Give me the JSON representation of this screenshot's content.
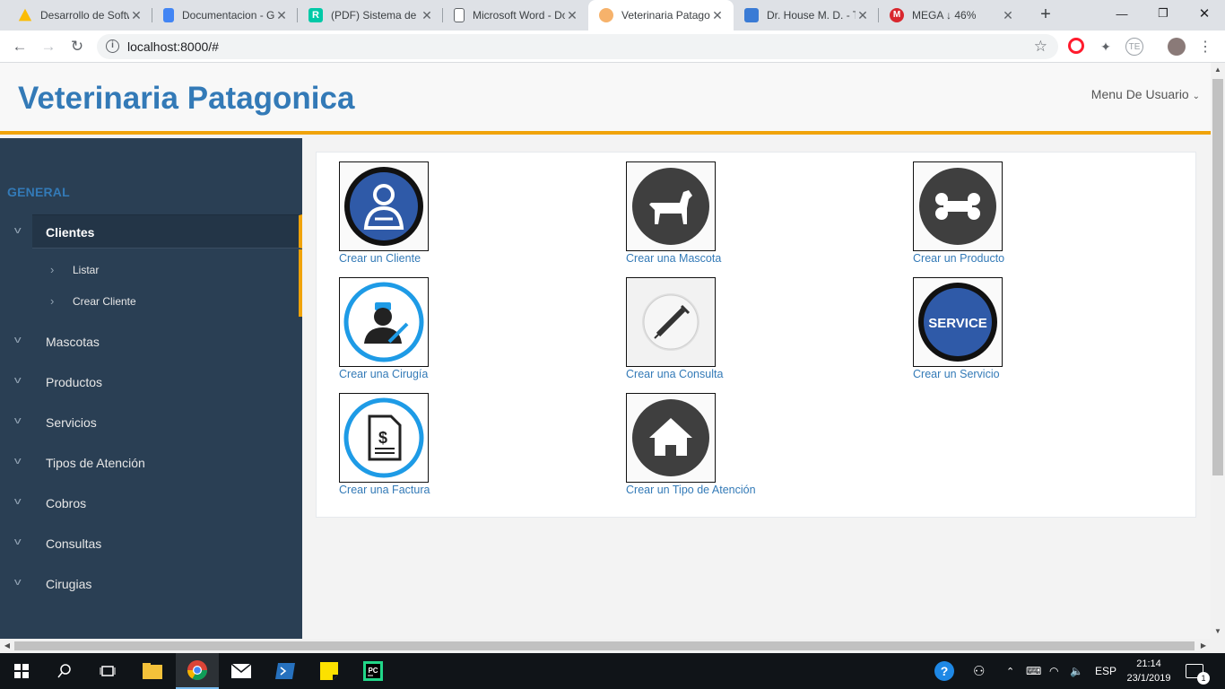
{
  "browser": {
    "tabs": [
      {
        "title": "Desarrollo de Software",
        "color": "#fbbc04",
        "active": false
      },
      {
        "title": "Documentacion - Google Docs",
        "color": "#4285f4",
        "active": false
      },
      {
        "title": "(PDF) Sistema de Gestión",
        "color": "#00c9a7",
        "active": false
      },
      {
        "title": "Microsoft Word - Document",
        "color": "#ffffff",
        "active": false
      },
      {
        "title": "Veterinaria Patagonica",
        "color": "#f6b26b",
        "active": true
      },
      {
        "title": "Dr. House M. D. - Temporada",
        "color": "#3a7bd5",
        "active": false
      },
      {
        "title": "MEGA ↓ 46%",
        "color": "#d9272e",
        "active": false
      }
    ],
    "url": "localhost:8000/#"
  },
  "header": {
    "brand": "Veterinaria Patagonica",
    "user_menu": "Menu De Usuario"
  },
  "sidebar": {
    "section": "GENERAL",
    "active_item": "Clientes",
    "sub_items": [
      "Listar",
      "Crear Cliente"
    ],
    "items": [
      "Mascotas",
      "Productos",
      "Servicios",
      "Tipos de Atención",
      "Cobros",
      "Consultas",
      "Cirugias"
    ]
  },
  "tiles": [
    {
      "caption": "Crear un Cliente",
      "icon": "user-icon"
    },
    {
      "caption": "Crear una Mascota",
      "icon": "dog-icon"
    },
    {
      "caption": "Crear un Producto",
      "icon": "bone-icon"
    },
    {
      "caption": "Crear una Cirugía",
      "icon": "surgeon-icon"
    },
    {
      "caption": "Crear una Consulta",
      "icon": "syringe-icon"
    },
    {
      "caption": "Crear un Servicio",
      "icon": "service-icon"
    },
    {
      "caption": "Crear una Factura",
      "icon": "invoice-icon"
    },
    {
      "caption": "Crear un Tipo de Atención",
      "icon": "house-icon"
    }
  ],
  "service_text": "SERVICE",
  "taskbar": {
    "lang": "ESP",
    "time": "21:14",
    "date": "23/1/2019",
    "notifications": "1"
  }
}
